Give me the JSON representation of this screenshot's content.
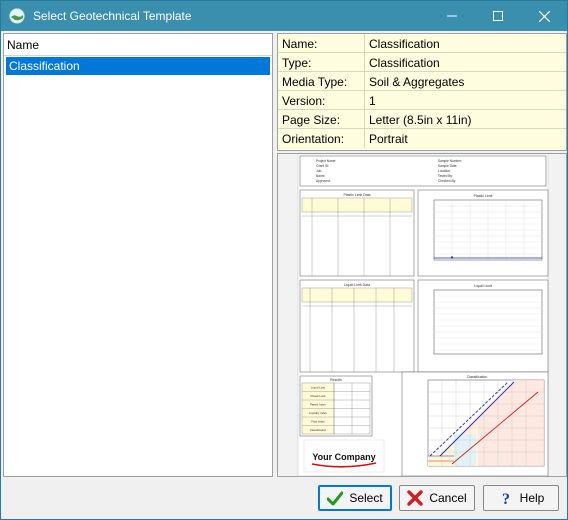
{
  "window": {
    "title": "Select Geotechnical Template"
  },
  "list": {
    "header": "Name",
    "items": [
      {
        "label": "Classification",
        "selected": true
      }
    ]
  },
  "info": {
    "rows": [
      {
        "key": "Name:",
        "value": "Classification"
      },
      {
        "key": "Type:",
        "value": "Classification"
      },
      {
        "key": "Media Type:",
        "value": "Soil & Aggregates"
      },
      {
        "key": "Version:",
        "value": "1"
      },
      {
        "key": "Page Size:",
        "value": "Letter (8.5in x 11in)"
      },
      {
        "key": "Orientation:",
        "value": "Portrait"
      }
    ]
  },
  "preview": {
    "header_left": [
      "Project Name:",
      "Client ID:",
      "Job:",
      "Name:",
      "Approved:"
    ],
    "header_right": [
      "Sample Number:",
      "Sample Date:",
      "Location:",
      "Tested By:",
      "Checked By:"
    ],
    "plastic_limit_table_title": "Plastic Limit Data",
    "plastic_limit_chart_title": "Plastic Limit",
    "liquid_limit_table_title": "Liquid Limit Data",
    "liquid_limit_chart_title": "Liquid Limit",
    "results_title": "Results",
    "results_rows": [
      "Liquid Limit",
      "Plastic Limit",
      "Plastic Index",
      "Liquidity Index",
      "Flow Index",
      "Classification"
    ],
    "classification_chart_title": "Classification",
    "company_logo": "Your Company"
  },
  "buttons": {
    "select": "Select",
    "cancel": "Cancel",
    "help": "Help"
  },
  "colors": {
    "titlebar": "#3a8fae",
    "selection": "#0078d7",
    "info_bg": "#fffde0"
  }
}
